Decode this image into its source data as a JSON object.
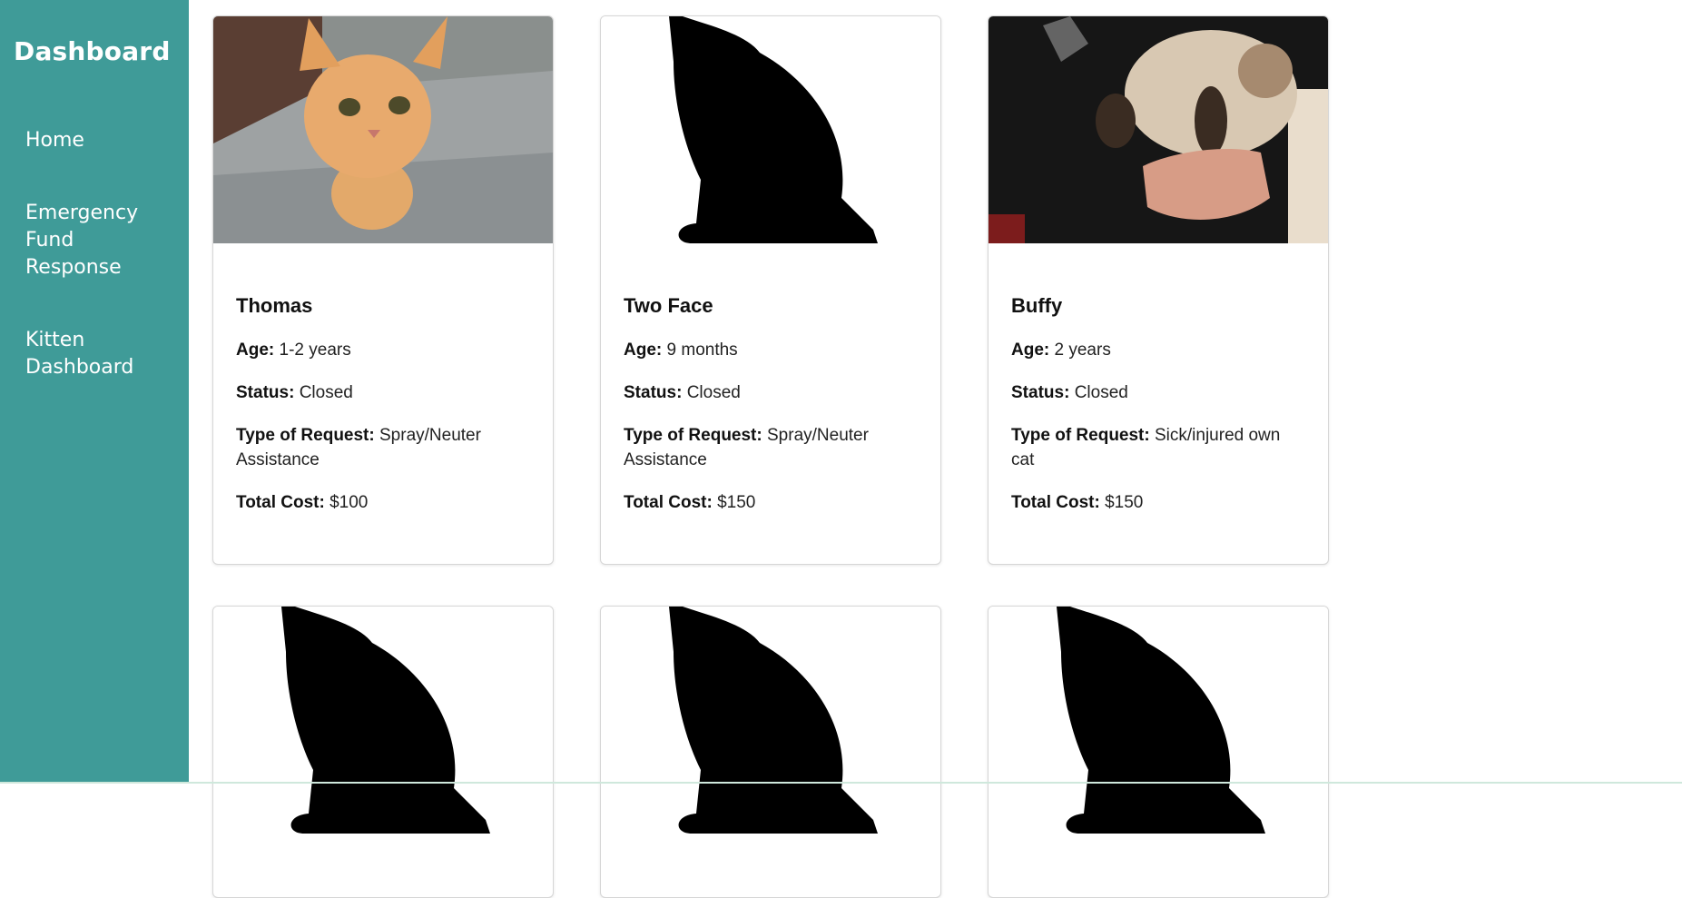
{
  "sidebar": {
    "title": "Dashboard",
    "items": [
      {
        "label": "Home"
      },
      {
        "label": "Emergency Fund Response"
      },
      {
        "label": "Kitten Dashboard"
      }
    ]
  },
  "labels": {
    "age": "Age:",
    "status": "Status:",
    "type": "Type of Request:",
    "cost": "Total Cost:"
  },
  "cards": [
    {
      "name": "Thomas",
      "age": "1-2 years",
      "status": "Closed",
      "type": "Spray/Neuter Assistance",
      "cost": "$100",
      "image": "orange-tabby-photo"
    },
    {
      "name": "Two Face",
      "age": "9 months",
      "status": "Closed",
      "type": "Spray/Neuter Assistance",
      "cost": "$150",
      "image": "cat-silhouette-placeholder"
    },
    {
      "name": "Buffy",
      "age": "2 years",
      "status": "Closed",
      "type": "Sick/injured own cat",
      "cost": "$150",
      "image": "siamese-cat-photo"
    }
  ],
  "partial_cards": [
    {
      "image": "cat-silhouette-placeholder"
    },
    {
      "image": "cat-silhouette-placeholder"
    },
    {
      "image": "cat-silhouette-placeholder"
    }
  ],
  "colors": {
    "sidebar": "#3f9b98",
    "card_border": "#d6d6d6"
  }
}
